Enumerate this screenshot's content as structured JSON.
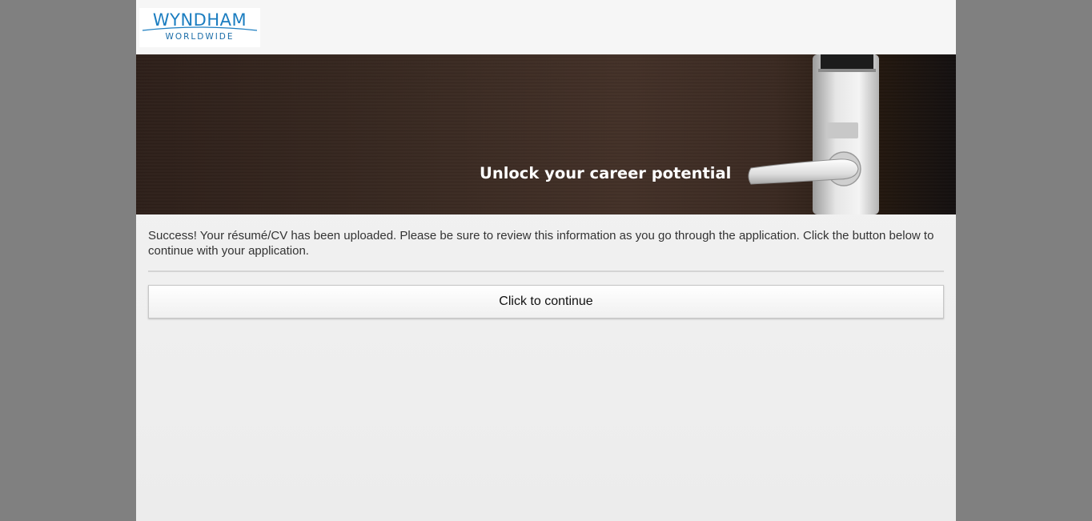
{
  "header": {
    "logo_main": "WYNDHAM",
    "logo_sub": "WORLDWIDE"
  },
  "banner": {
    "tagline": "Unlock your career potential"
  },
  "main": {
    "message": "Success! Your résumé/CV has been uploaded. Please be sure to review this information as you go through the application. Click the button below to continue with your application.",
    "continue_label": "Click to continue"
  },
  "colors": {
    "brand_blue": "#1b7dc0",
    "backdrop": "#808080",
    "panel": "#f0f0f0"
  }
}
